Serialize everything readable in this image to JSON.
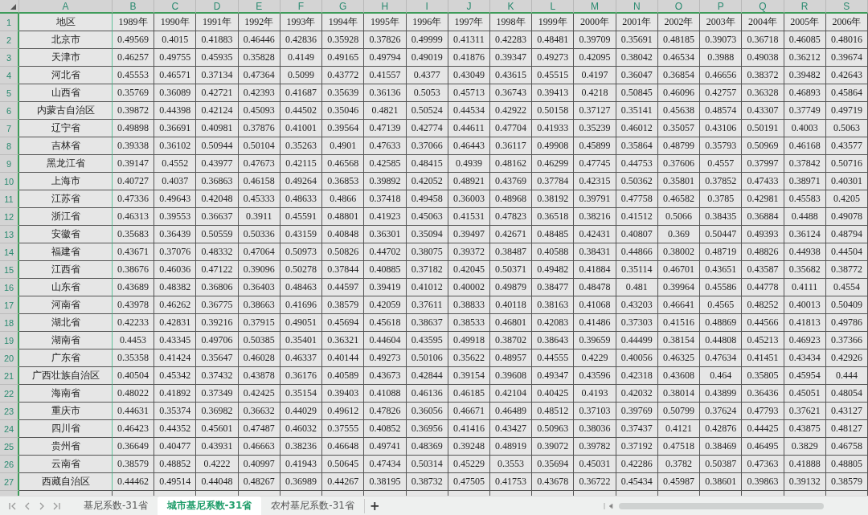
{
  "columns": [
    "A",
    "B",
    "C",
    "D",
    "E",
    "F",
    "G",
    "H",
    "I",
    "J",
    "K",
    "L",
    "M",
    "N",
    "O",
    "P",
    "Q",
    "R",
    "S"
  ],
  "rows": [
    {
      "number": "1",
      "cells": [
        "地区",
        "1989年",
        "1990年",
        "1991年",
        "1992年",
        "1993年",
        "1994年",
        "1995年",
        "1996年",
        "1997年",
        "1998年",
        "1999年",
        "2000年",
        "2001年",
        "2002年",
        "2003年",
        "2004年",
        "2005年",
        "2006年"
      ]
    },
    {
      "number": "2",
      "cells": [
        "北京市",
        "0.49569",
        "0.4015",
        "0.41883",
        "0.46446",
        "0.42836",
        "0.35928",
        "0.37826",
        "0.49999",
        "0.41311",
        "0.42283",
        "0.48481",
        "0.39709",
        "0.35691",
        "0.48185",
        "0.39073",
        "0.36718",
        "0.46085",
        "0.48016"
      ]
    },
    {
      "number": "3",
      "cells": [
        "天津市",
        "0.46257",
        "0.49755",
        "0.45935",
        "0.35828",
        "0.4149",
        "0.49165",
        "0.49794",
        "0.49019",
        "0.41876",
        "0.39347",
        "0.49273",
        "0.42095",
        "0.38042",
        "0.46534",
        "0.3988",
        "0.49038",
        "0.36212",
        "0.39674"
      ]
    },
    {
      "number": "4",
      "cells": [
        "河北省",
        "0.45553",
        "0.46571",
        "0.37134",
        "0.47364",
        "0.5099",
        "0.43772",
        "0.41557",
        "0.4377",
        "0.43049",
        "0.43615",
        "0.45515",
        "0.4197",
        "0.36047",
        "0.36854",
        "0.46656",
        "0.38372",
        "0.39482",
        "0.42643"
      ]
    },
    {
      "number": "5",
      "cells": [
        "山西省",
        "0.35769",
        "0.36089",
        "0.42721",
        "0.42393",
        "0.41687",
        "0.35639",
        "0.36136",
        "0.5053",
        "0.45713",
        "0.36743",
        "0.39413",
        "0.4218",
        "0.50845",
        "0.46096",
        "0.42757",
        "0.36328",
        "0.46893",
        "0.45864"
      ]
    },
    {
      "number": "6",
      "cells": [
        "内蒙古自治区",
        "0.39872",
        "0.44398",
        "0.42124",
        "0.45093",
        "0.44502",
        "0.35046",
        "0.4821",
        "0.50524",
        "0.44534",
        "0.42922",
        "0.50158",
        "0.37127",
        "0.35141",
        "0.45638",
        "0.48574",
        "0.43307",
        "0.37749",
        "0.49719"
      ]
    },
    {
      "number": "7",
      "cells": [
        "辽宁省",
        "0.49898",
        "0.36691",
        "0.40981",
        "0.37876",
        "0.41001",
        "0.39564",
        "0.47139",
        "0.42774",
        "0.44611",
        "0.47704",
        "0.41933",
        "0.35239",
        "0.46012",
        "0.35057",
        "0.43106",
        "0.50191",
        "0.4003",
        "0.5063"
      ]
    },
    {
      "number": "8",
      "cells": [
        "吉林省",
        "0.39338",
        "0.36102",
        "0.50944",
        "0.50104",
        "0.35263",
        "0.4901",
        "0.47633",
        "0.37066",
        "0.46443",
        "0.36117",
        "0.49908",
        "0.45899",
        "0.35864",
        "0.48799",
        "0.35793",
        "0.50969",
        "0.46168",
        "0.43577"
      ]
    },
    {
      "number": "9",
      "cells": [
        "黑龙江省",
        "0.39147",
        "0.4552",
        "0.43977",
        "0.47673",
        "0.42115",
        "0.46568",
        "0.42585",
        "0.48415",
        "0.4939",
        "0.48162",
        "0.46299",
        "0.47745",
        "0.44753",
        "0.37606",
        "0.4557",
        "0.37997",
        "0.37842",
        "0.50716"
      ]
    },
    {
      "number": "10",
      "cells": [
        "上海市",
        "0.40727",
        "0.4037",
        "0.36863",
        "0.46158",
        "0.49264",
        "0.36853",
        "0.39892",
        "0.42052",
        "0.48921",
        "0.43769",
        "0.37784",
        "0.42315",
        "0.50362",
        "0.35801",
        "0.37852",
        "0.47433",
        "0.38971",
        "0.40301"
      ]
    },
    {
      "number": "11",
      "cells": [
        "江苏省",
        "0.47336",
        "0.49643",
        "0.42048",
        "0.45333",
        "0.48633",
        "0.4866",
        "0.37418",
        "0.49458",
        "0.36003",
        "0.48968",
        "0.38192",
        "0.39791",
        "0.47758",
        "0.46582",
        "0.3785",
        "0.42981",
        "0.45583",
        "0.4205"
      ]
    },
    {
      "number": "12",
      "cells": [
        "浙江省",
        "0.46313",
        "0.39553",
        "0.36637",
        "0.3911",
        "0.45591",
        "0.48801",
        "0.41923",
        "0.45063",
        "0.41531",
        "0.47823",
        "0.36518",
        "0.38216",
        "0.41512",
        "0.5066",
        "0.38435",
        "0.36884",
        "0.4488",
        "0.49078"
      ]
    },
    {
      "number": "13",
      "cells": [
        "安徽省",
        "0.35683",
        "0.36439",
        "0.50559",
        "0.50336",
        "0.43159",
        "0.40848",
        "0.36301",
        "0.35094",
        "0.39497",
        "0.42671",
        "0.48485",
        "0.42431",
        "0.40807",
        "0.369",
        "0.50447",
        "0.49393",
        "0.36124",
        "0.48794"
      ]
    },
    {
      "number": "14",
      "cells": [
        "福建省",
        "0.43671",
        "0.37076",
        "0.48332",
        "0.47064",
        "0.50973",
        "0.50826",
        "0.44702",
        "0.38075",
        "0.39372",
        "0.38487",
        "0.40588",
        "0.38431",
        "0.44866",
        "0.38002",
        "0.48719",
        "0.48826",
        "0.44938",
        "0.44504"
      ]
    },
    {
      "number": "15",
      "cells": [
        "江西省",
        "0.38676",
        "0.46036",
        "0.47122",
        "0.39096",
        "0.50278",
        "0.37844",
        "0.40885",
        "0.37182",
        "0.42045",
        "0.50371",
        "0.49482",
        "0.41884",
        "0.35114",
        "0.46701",
        "0.43651",
        "0.43587",
        "0.35682",
        "0.38772"
      ]
    },
    {
      "number": "16",
      "cells": [
        "山东省",
        "0.43689",
        "0.48382",
        "0.36806",
        "0.36403",
        "0.48463",
        "0.44597",
        "0.39419",
        "0.41012",
        "0.40002",
        "0.49879",
        "0.38477",
        "0.48478",
        "0.481",
        "0.39964",
        "0.45586",
        "0.44778",
        "0.4111",
        "0.4554"
      ]
    },
    {
      "number": "17",
      "cells": [
        "河南省",
        "0.43978",
        "0.46262",
        "0.36775",
        "0.38663",
        "0.41696",
        "0.38579",
        "0.42059",
        "0.37611",
        "0.38833",
        "0.40118",
        "0.38163",
        "0.41068",
        "0.43203",
        "0.46641",
        "0.4565",
        "0.48252",
        "0.40013",
        "0.50409"
      ]
    },
    {
      "number": "18",
      "cells": [
        "湖北省",
        "0.42233",
        "0.42831",
        "0.39216",
        "0.37915",
        "0.49051",
        "0.45694",
        "0.45618",
        "0.38637",
        "0.38533",
        "0.46801",
        "0.42083",
        "0.41486",
        "0.37303",
        "0.41516",
        "0.48869",
        "0.44566",
        "0.41813",
        "0.49786"
      ]
    },
    {
      "number": "19",
      "cells": [
        "湖南省",
        "0.4453",
        "0.43345",
        "0.49706",
        "0.50385",
        "0.35401",
        "0.36321",
        "0.44604",
        "0.43595",
        "0.49918",
        "0.38702",
        "0.38643",
        "0.39659",
        "0.44499",
        "0.38154",
        "0.44808",
        "0.45213",
        "0.46923",
        "0.37366"
      ]
    },
    {
      "number": "20",
      "cells": [
        "广东省",
        "0.35358",
        "0.41424",
        "0.35647",
        "0.46028",
        "0.46337",
        "0.40144",
        "0.49273",
        "0.50106",
        "0.35622",
        "0.48957",
        "0.44555",
        "0.4229",
        "0.40056",
        "0.46325",
        "0.47634",
        "0.41451",
        "0.43434",
        "0.42926"
      ]
    },
    {
      "number": "21",
      "cells": [
        "广西壮族自治区",
        "0.40504",
        "0.45342",
        "0.37432",
        "0.43878",
        "0.36176",
        "0.40589",
        "0.43673",
        "0.42844",
        "0.39154",
        "0.39608",
        "0.49347",
        "0.43596",
        "0.42318",
        "0.43608",
        "0.464",
        "0.35805",
        "0.45954",
        "0.444"
      ]
    },
    {
      "number": "22",
      "cells": [
        "海南省",
        "0.48022",
        "0.41892",
        "0.37349",
        "0.42425",
        "0.35154",
        "0.39403",
        "0.41088",
        "0.46136",
        "0.46185",
        "0.42104",
        "0.40425",
        "0.4193",
        "0.42032",
        "0.38014",
        "0.43899",
        "0.36436",
        "0.45051",
        "0.48054"
      ]
    },
    {
      "number": "23",
      "cells": [
        "重庆市",
        "0.44631",
        "0.35374",
        "0.36982",
        "0.36632",
        "0.44029",
        "0.49612",
        "0.47826",
        "0.36056",
        "0.46671",
        "0.46489",
        "0.48512",
        "0.37103",
        "0.39769",
        "0.50799",
        "0.37624",
        "0.47793",
        "0.37621",
        "0.43127"
      ]
    },
    {
      "number": "24",
      "cells": [
        "四川省",
        "0.46423",
        "0.44352",
        "0.45601",
        "0.47487",
        "0.46032",
        "0.37555",
        "0.40852",
        "0.36956",
        "0.41416",
        "0.43427",
        "0.50963",
        "0.38036",
        "0.37437",
        "0.4121",
        "0.42876",
        "0.44425",
        "0.43875",
        "0.48127"
      ]
    },
    {
      "number": "25",
      "cells": [
        "贵州省",
        "0.36649",
        "0.40477",
        "0.43931",
        "0.46663",
        "0.38236",
        "0.46648",
        "0.49741",
        "0.48369",
        "0.39248",
        "0.48919",
        "0.39072",
        "0.39782",
        "0.37192",
        "0.47518",
        "0.38469",
        "0.46495",
        "0.3829",
        "0.46758"
      ]
    },
    {
      "number": "26",
      "cells": [
        "云南省",
        "0.38579",
        "0.48852",
        "0.4222",
        "0.40997",
        "0.41943",
        "0.50645",
        "0.47434",
        "0.50314",
        "0.45229",
        "0.3553",
        "0.35694",
        "0.45031",
        "0.42286",
        "0.3782",
        "0.50387",
        "0.47363",
        "0.41888",
        "0.48805"
      ]
    },
    {
      "number": "27",
      "cells": [
        "西藏自治区",
        "0.44462",
        "0.49514",
        "0.44048",
        "0.48267",
        "0.36989",
        "0.44267",
        "0.38195",
        "0.38732",
        "0.47505",
        "0.41753",
        "0.43678",
        "0.36722",
        "0.45434",
        "0.45987",
        "0.38601",
        "0.39863",
        "0.39132",
        "0.38579"
      ]
    }
  ],
  "sheet_tabs": [
    {
      "label": "基尼系数-31省",
      "selected": false
    },
    {
      "label": "城市基尼系数-31省",
      "selected": true
    },
    {
      "label": "农村基尼系数-31省",
      "selected": false
    }
  ],
  "add_sheet": "+"
}
